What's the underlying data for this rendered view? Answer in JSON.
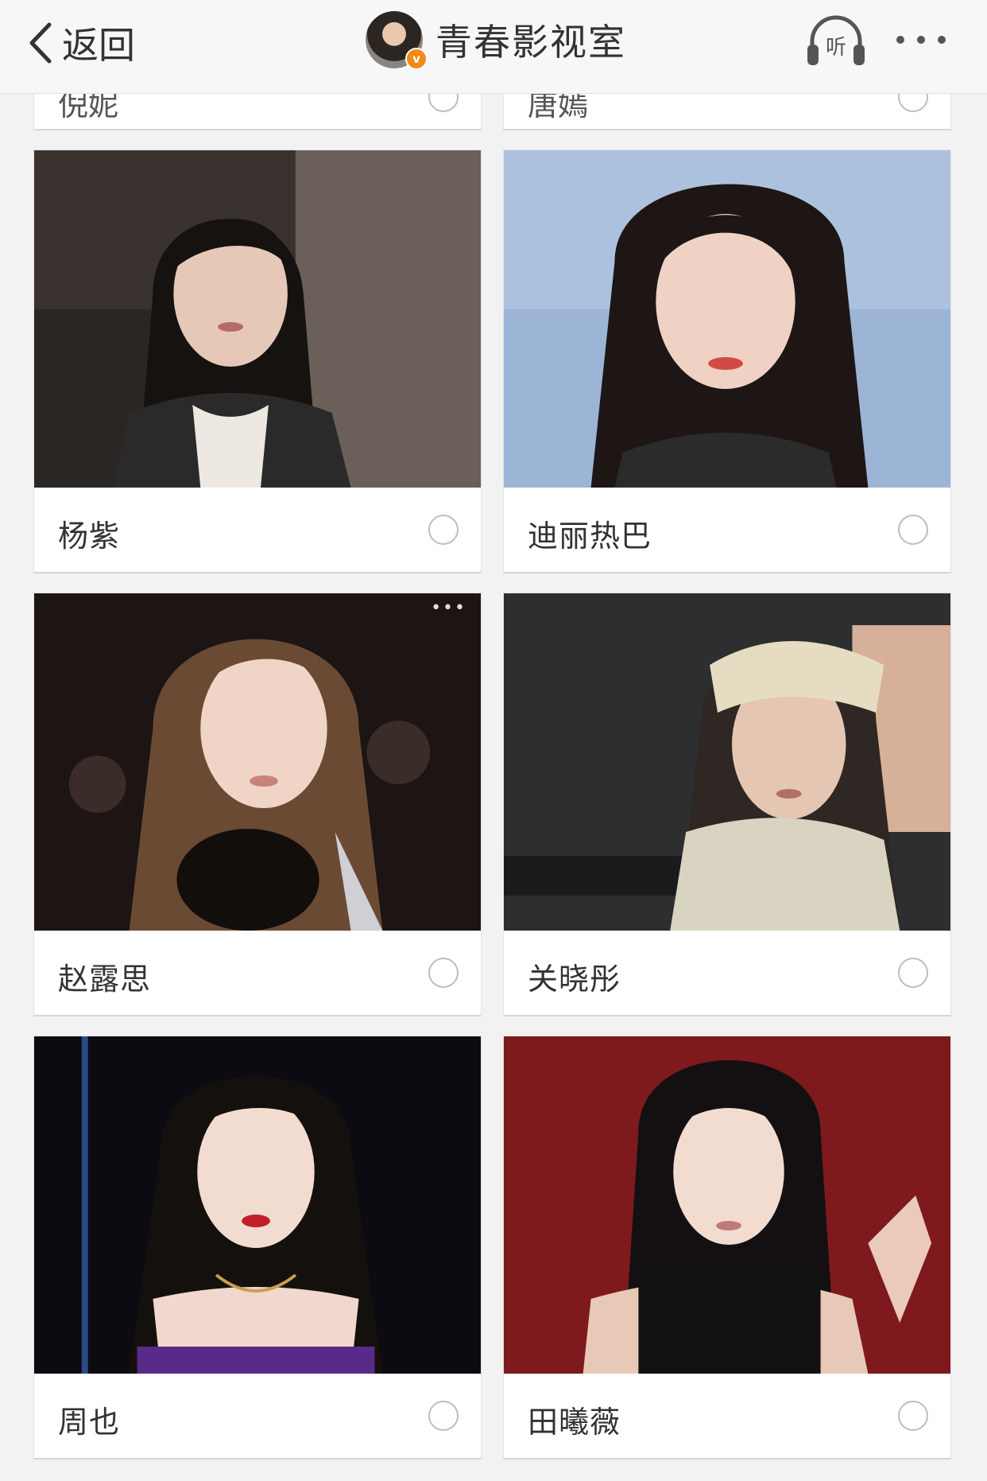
{
  "header": {
    "back_label": "返回",
    "title": "青春影视室",
    "verified_badge": "v",
    "icons": [
      "back-chevron-icon",
      "listen-headphones-icon",
      "more-dots-icon"
    ],
    "listen_label": "听"
  },
  "cards": [
    {
      "name": "倪妮"
    },
    {
      "name": "唐嫣"
    },
    {
      "name": "杨紫"
    },
    {
      "name": "迪丽热巴"
    },
    {
      "name": "赵露思"
    },
    {
      "name": "关晓彤"
    },
    {
      "name": "周也"
    },
    {
      "name": "田曦薇"
    }
  ],
  "colors": {
    "accent_badge": "#f08a18",
    "text": "#333333"
  }
}
